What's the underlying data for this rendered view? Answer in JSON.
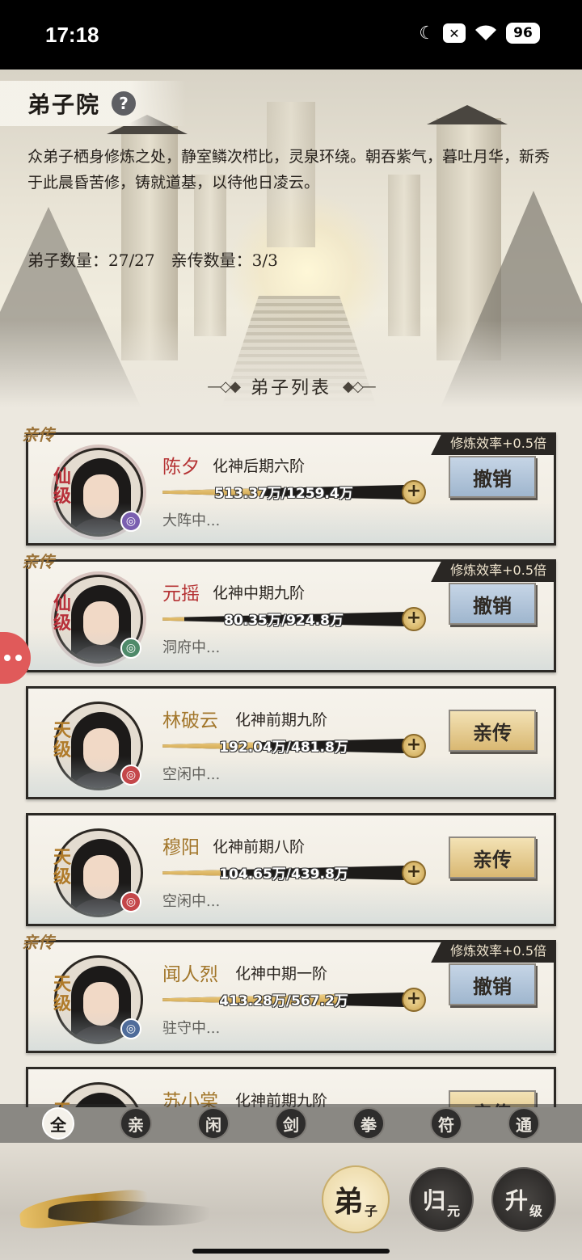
{
  "status_bar": {
    "time": "17:18",
    "battery": "96",
    "icons": [
      "moon-icon",
      "close-box-icon",
      "wifi-icon",
      "battery-icon"
    ]
  },
  "header": {
    "title": "弟子院",
    "help": "?"
  },
  "description": "众弟子栖身修炼之处，静室鳞次栉比，灵泉环绕。朝吞紫气，暮吐月华，新秀于此晨昏苦修，铸就道基，以待他日凌云。",
  "counts": {
    "disciples": "弟子数量：27/27",
    "direct": "亲传数量：3/3"
  },
  "section_title": "弟子列表",
  "disciples": [
    {
      "tag": "亲传",
      "bonus": "修炼效率+0.5倍",
      "grade": "仙级",
      "name": "陈夕",
      "realm": "化神后期六阶",
      "progress_text": "513.37万/1259.4万",
      "progress": 0.41,
      "status": "大阵中...",
      "action": "撤销",
      "element_color": "#7a5fb0",
      "element_icon": "swirl-icon"
    },
    {
      "tag": "亲传",
      "bonus": "修炼效率+0.5倍",
      "grade": "仙级",
      "name": "元摇",
      "realm": "化神中期九阶",
      "progress_text": "80.35万/924.8万",
      "progress": 0.09,
      "status": "洞府中...",
      "action": "撤销",
      "element_color": "#4f8a6a",
      "element_icon": "vortex-icon"
    },
    {
      "tag": "",
      "bonus": "",
      "grade": "天级",
      "name": "林破云",
      "realm": "化神前期九阶",
      "progress_text": "192.04万/481.8万",
      "progress": 0.4,
      "status": "空闲中...",
      "action": "亲传",
      "element_color": "#c4474a",
      "element_icon": "fist-icon"
    },
    {
      "tag": "",
      "bonus": "",
      "grade": "天级",
      "name": "穆阳",
      "realm": "化神前期八阶",
      "progress_text": "104.65万/439.8万",
      "progress": 0.24,
      "status": "空闲中...",
      "action": "亲传",
      "element_color": "#c4474a",
      "element_icon": "fist-icon"
    },
    {
      "tag": "亲传",
      "bonus": "修炼效率+0.5倍",
      "grade": "天级",
      "name": "闻人烈",
      "realm": "化神中期一阶",
      "progress_text": "413.28万/567.2万",
      "progress": 0.73,
      "status": "驻守中...",
      "action": "撤销",
      "element_color": "#4f6c9a",
      "element_icon": "sword-icon"
    },
    {
      "tag": "",
      "bonus": "",
      "grade": "天级",
      "name": "苏小棠",
      "realm": "化神前期九阶",
      "progress_text": "",
      "progress": 0.3,
      "status": "",
      "action": "亲传",
      "element_color": "#c4474a",
      "element_icon": "fist-icon"
    }
  ],
  "filters": [
    "全",
    "亲",
    "闲",
    "剑",
    "拳",
    "符",
    "通"
  ],
  "bottom_nav": [
    {
      "main": "弟",
      "sub": "子"
    },
    {
      "main": "归",
      "sub": "元"
    },
    {
      "main": "升",
      "sub": "级"
    }
  ]
}
